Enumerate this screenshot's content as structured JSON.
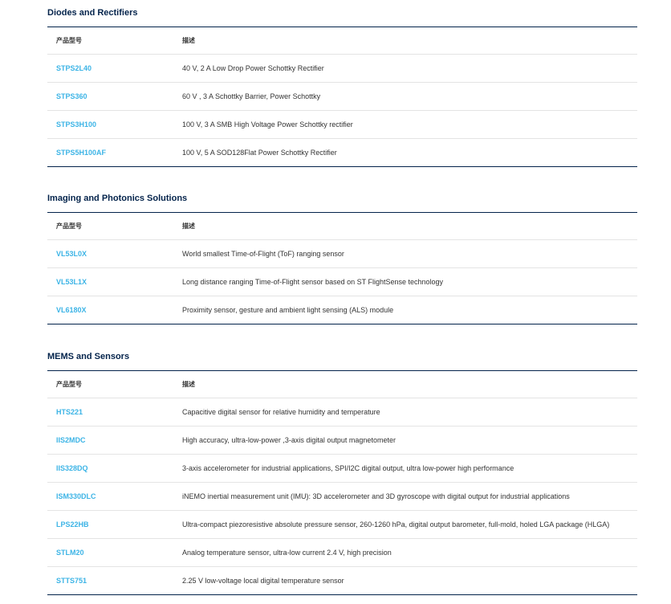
{
  "sections": [
    {
      "title": "Diodes and Rectifiers",
      "headers": [
        "产品型号",
        "描述"
      ],
      "rows": [
        {
          "part": "STPS2L40",
          "desc": "40 V, 2 A Low Drop Power Schottky Rectifier"
        },
        {
          "part": "STPS360",
          "desc": "60 V , 3 A Schottky Barrier, Power Schottky"
        },
        {
          "part": "STPS3H100",
          "desc": "100 V, 3 A SMB High Voltage Power Schottky rectifier"
        },
        {
          "part": "STPS5H100AF",
          "desc": "100 V, 5 A SOD128Flat Power Schottky Rectifier"
        }
      ]
    },
    {
      "title": "Imaging and Photonics Solutions",
      "headers": [
        "产品型号",
        "描述"
      ],
      "rows": [
        {
          "part": "VL53L0X",
          "desc": "World smallest Time-of-Flight (ToF) ranging sensor"
        },
        {
          "part": "VL53L1X",
          "desc": "Long distance ranging Time-of-Flight sensor based on ST FlightSense technology"
        },
        {
          "part": "VL6180X",
          "desc": "Proximity sensor, gesture and ambient light sensing (ALS) module"
        }
      ]
    },
    {
      "title": "MEMS and Sensors",
      "headers": [
        "产品型号",
        "描述"
      ],
      "rows": [
        {
          "part": "HTS221",
          "desc": "Capacitive digital sensor for relative humidity and temperature"
        },
        {
          "part": "IIS2MDC",
          "desc": "High accuracy, ultra-low-power ,3-axis digital output magnetometer"
        },
        {
          "part": "IIS328DQ",
          "desc": "3-axis accelerometer for industrial applications, SPI/I2C digital output, ultra low-power high performance"
        },
        {
          "part": "ISM330DLC",
          "desc": "iNEMO inertial measurement unit (IMU): 3D accelerometer and 3D gyroscope with digital output for industrial applications"
        },
        {
          "part": "LPS22HB",
          "desc": "Ultra-compact piezoresistive absolute pressure sensor, 260-1260 hPa, digital output barometer, full-mold, holed LGA package (HLGA)"
        },
        {
          "part": "STLM20",
          "desc": "Analog temperature sensor, ultra-low current 2.4 V, high precision"
        },
        {
          "part": "STTS751",
          "desc": "2.25 V low-voltage local digital temperature sensor"
        }
      ]
    }
  ],
  "colors": {
    "title": "#03234b",
    "link": "#3cb4e6",
    "rule": "#e4e4e4"
  }
}
